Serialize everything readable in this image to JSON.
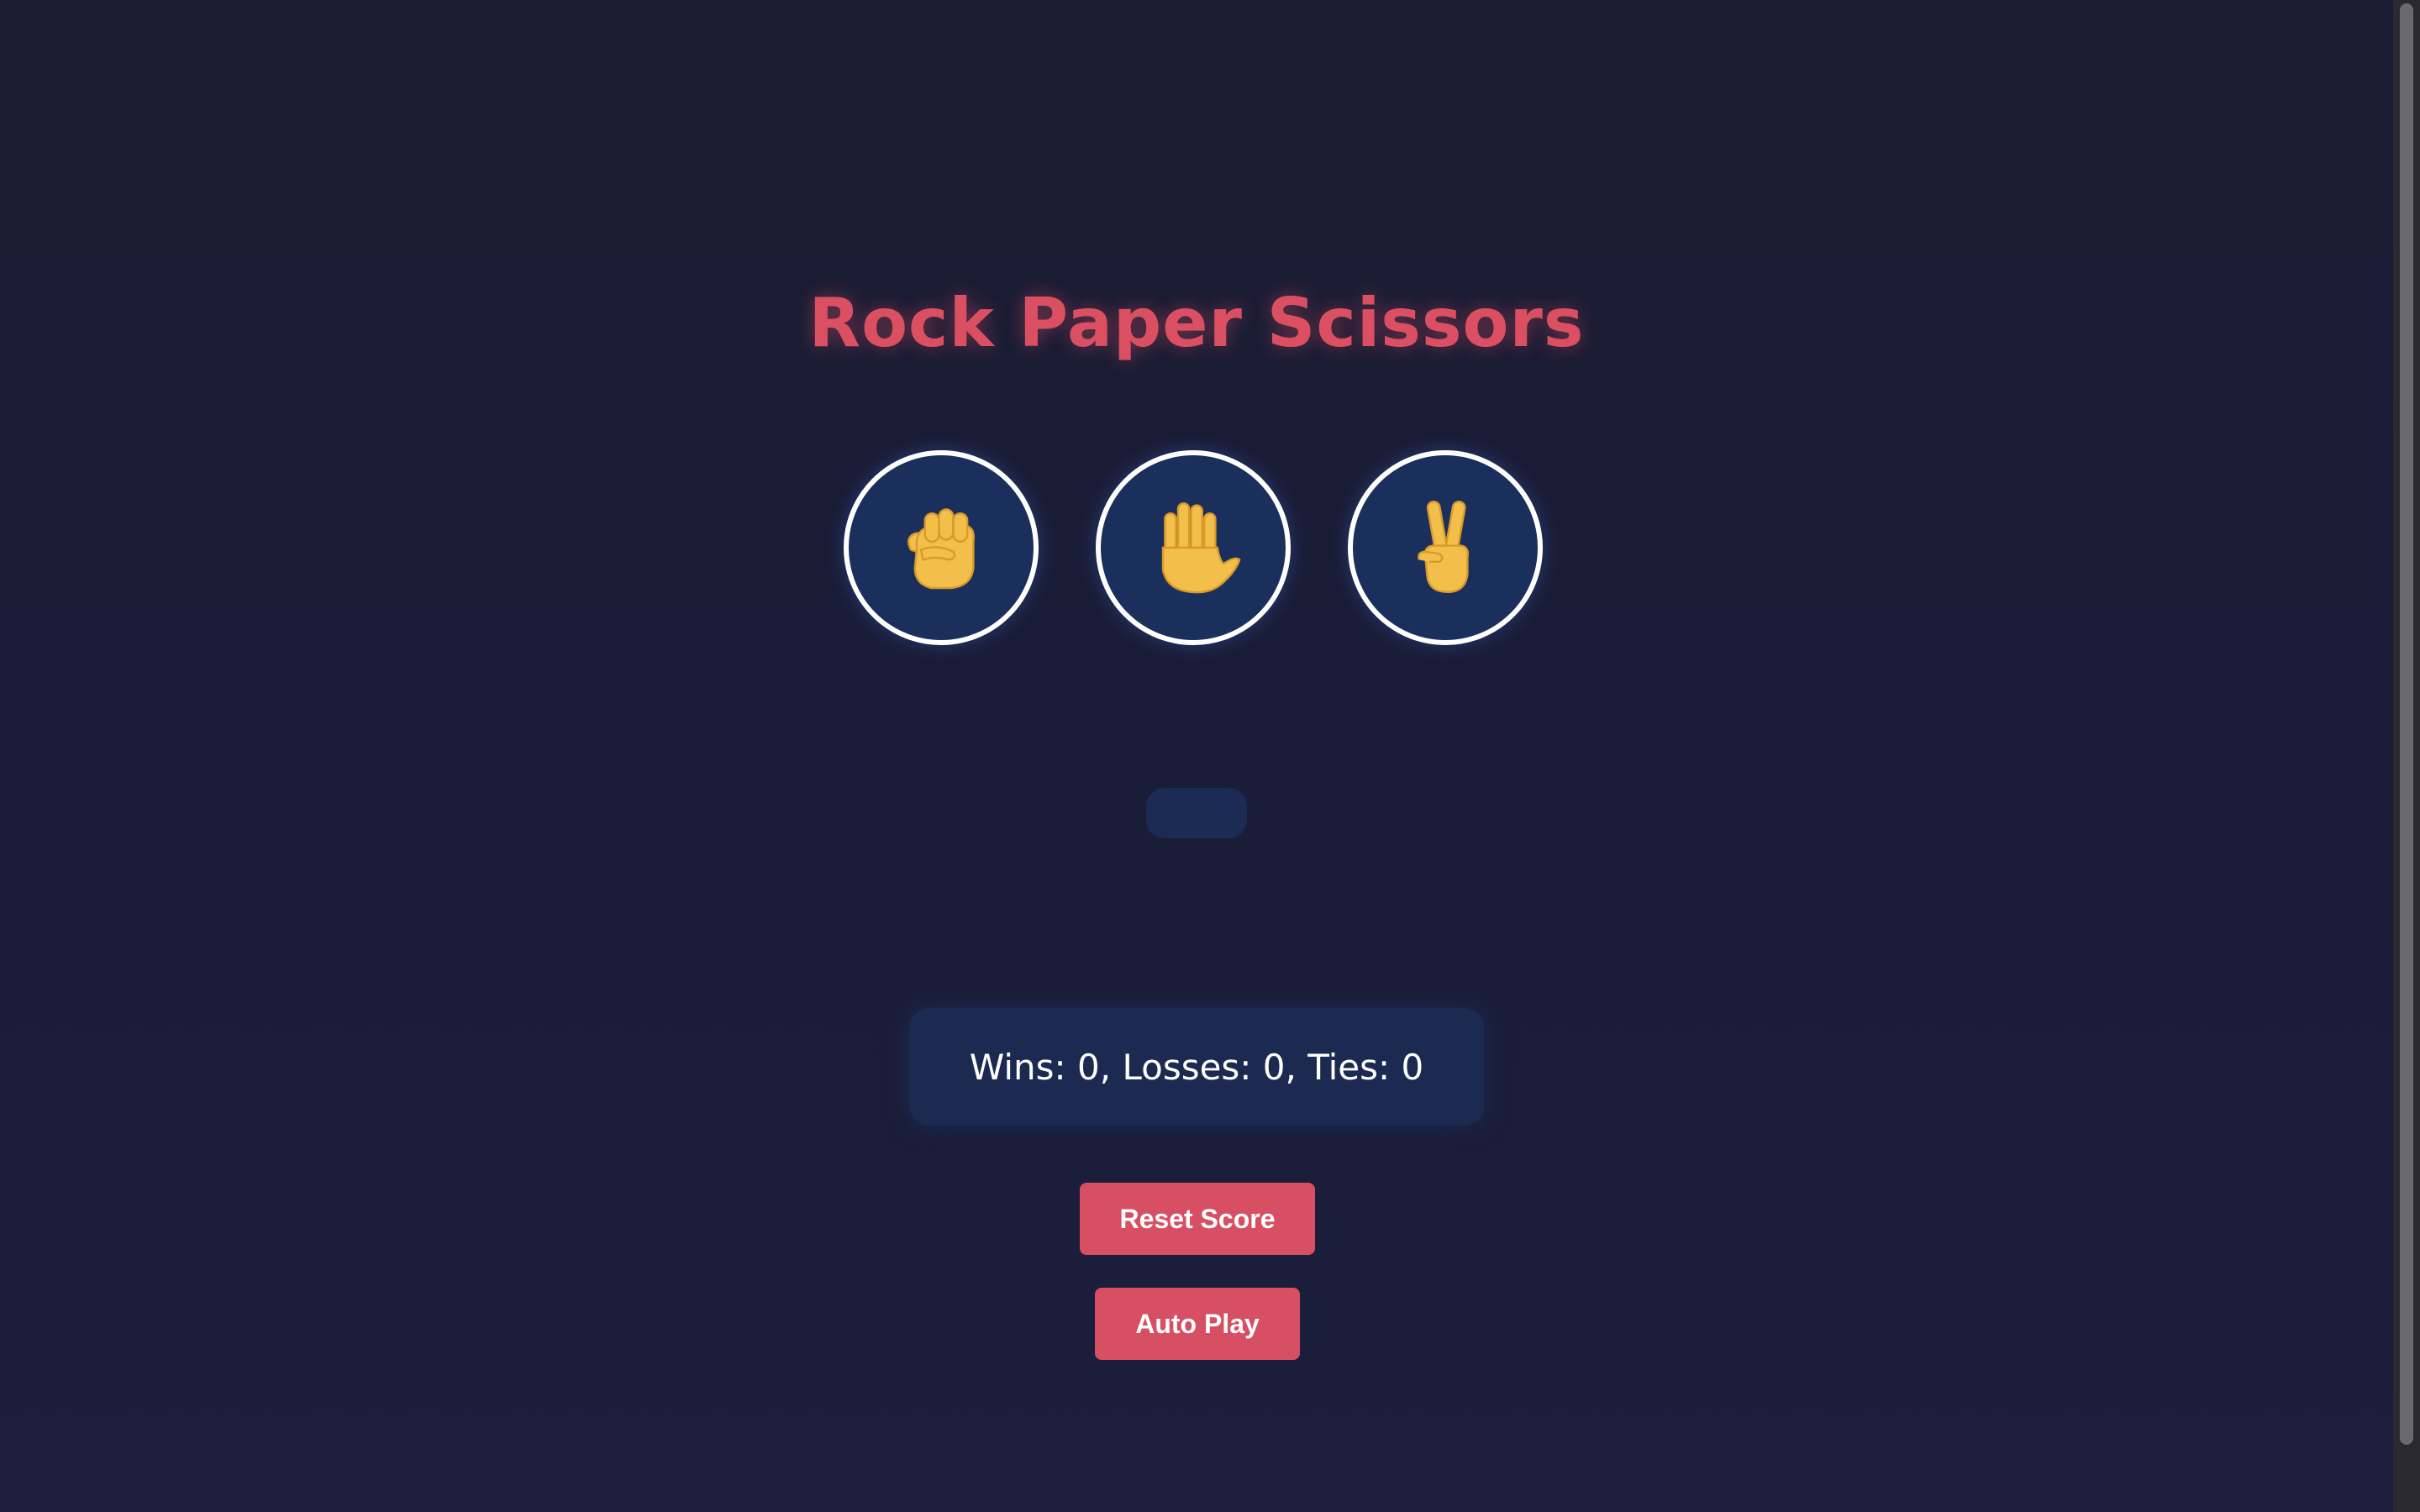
{
  "title": "Rock Paper Scissors",
  "choices": [
    {
      "name": "rock",
      "icon": "raised-fist-icon"
    },
    {
      "name": "paper",
      "icon": "raised-hand-icon"
    },
    {
      "name": "scissors",
      "icon": "victory-hand-icon"
    }
  ],
  "result": "",
  "score": {
    "text": "Wins: 0, Losses: 0, Ties: 0"
  },
  "buttons": {
    "reset_label": "Reset Score",
    "auto_label": "Auto Play"
  },
  "colors": {
    "accent": "#db4f62",
    "button": "#d64f62",
    "choice_fill": "#1a2f5c",
    "background": "#1b1c33",
    "emoji": "#f2c04a"
  }
}
